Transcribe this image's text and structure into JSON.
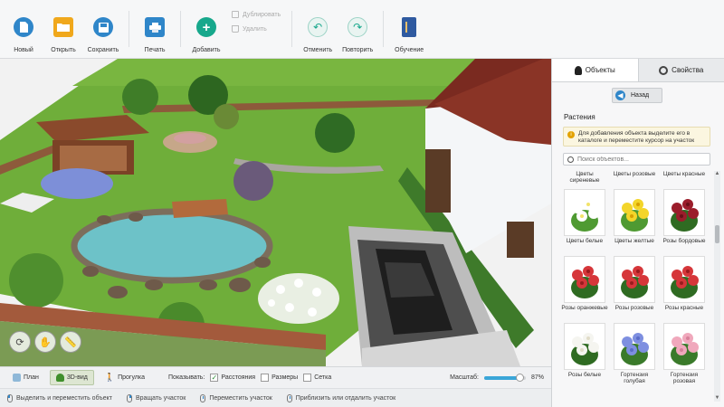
{
  "toolbar": {
    "new": {
      "label": "Новый",
      "icon": "new-document-icon",
      "color": "#2f86c9"
    },
    "open": {
      "label": "Открыть",
      "icon": "folder-icon",
      "color": "#f0a81c"
    },
    "save": {
      "label": "Сохранить",
      "icon": "save-disk-icon",
      "color": "#2f86c9"
    },
    "print": {
      "label": "Печать",
      "icon": "printer-icon",
      "color": "#2f86c9"
    },
    "add": {
      "label": "Добавить",
      "icon": "plus-icon",
      "color": "#17a88c"
    },
    "duplicate": {
      "label": "Дублировать",
      "icon": "duplicate-icon"
    },
    "delete": {
      "label": "Удалить",
      "icon": "trash-icon"
    },
    "undo": {
      "label": "Отменить",
      "icon": "undo-icon",
      "color": "#17a88c"
    },
    "redo": {
      "label": "Повторить",
      "icon": "redo-icon",
      "color": "#17a88c"
    },
    "learn": {
      "label": "Обучение",
      "icon": "book-icon",
      "color": "#2f5aa0"
    }
  },
  "viewbar": {
    "plan": "План",
    "view3d": "3D-вид",
    "walk": "Прогулка",
    "show_label": "Показывать:",
    "distances": "Расстояния",
    "sizes": "Размеры",
    "grid": "Сетка",
    "distances_checked": true,
    "sizes_checked": false,
    "grid_checked": false,
    "scale_label": "Масштаб:",
    "scale_value": "87%",
    "scale_fraction": 0.87
  },
  "status": {
    "select": "Выделить и переместить объект",
    "rotate": "Вращать участок",
    "move": "Переместить участок",
    "zoom": "Приблизить или отдалить участок"
  },
  "panel": {
    "tab_objects": "Объекты",
    "tab_properties": "Свойства",
    "back": "Назад",
    "category": "Растения",
    "hint": "Для добавления объекта выделите его в каталоге и переместите курсор на участок",
    "search_placeholder": "Поиск объектов...",
    "top_labels": [
      "Цветы сиреневые",
      "Цветы розовые",
      "Цветы красные"
    ],
    "items": [
      {
        "label": "Цветы белые",
        "kind": "white-flower"
      },
      {
        "label": "Цветы желтые",
        "kind": "yellow-flower"
      },
      {
        "label": "Розы бордовые",
        "kind": "burgundy-rose"
      },
      {
        "label": "Розы оранжевые",
        "kind": "red-rose"
      },
      {
        "label": "Розы розовые",
        "kind": "red-rose"
      },
      {
        "label": "Розы красные",
        "kind": "red-rose"
      },
      {
        "label": "Розы белые",
        "kind": "white-rose"
      },
      {
        "label": "Гортензия голубая",
        "kind": "blue-hydrangea"
      },
      {
        "label": "Гортензия розовая",
        "kind": "pink-hydrangea"
      }
    ]
  }
}
